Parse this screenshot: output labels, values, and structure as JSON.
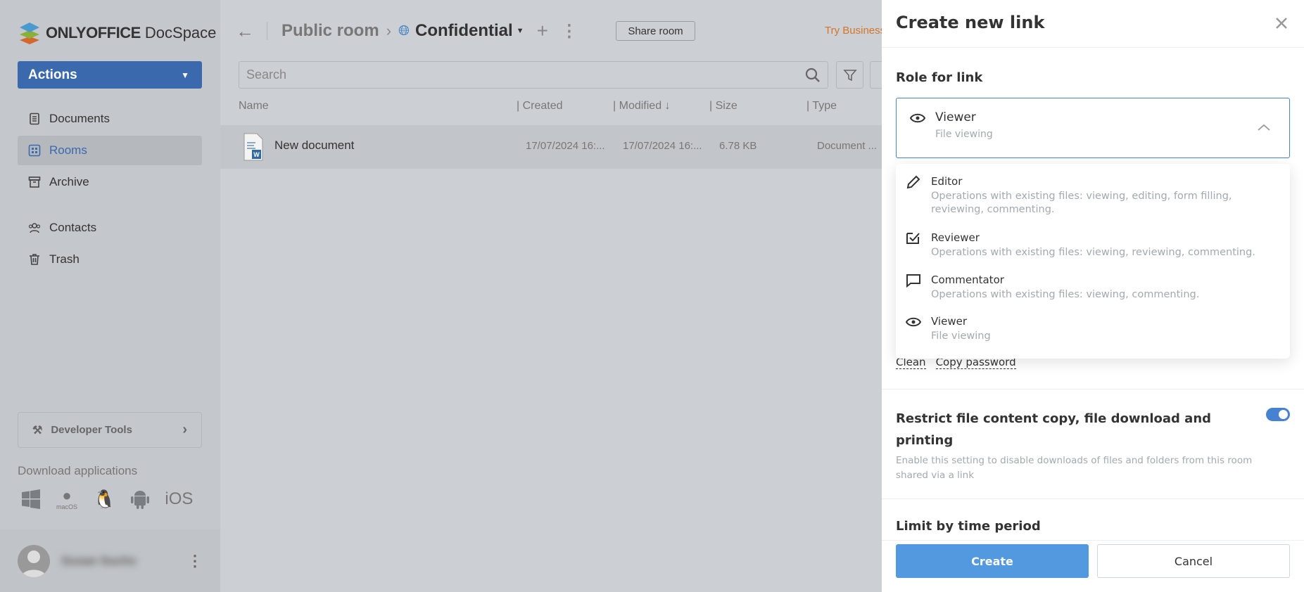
{
  "brand": {
    "logo_bold": "ONLYOFFICE",
    "logo_light": "DocSpace"
  },
  "sidebar": {
    "actions_label": "Actions",
    "items": [
      {
        "label": "Documents",
        "icon": "document-icon"
      },
      {
        "label": "Rooms",
        "icon": "rooms-icon",
        "active": true
      },
      {
        "label": "Archive",
        "icon": "archive-icon"
      },
      {
        "label": "Contacts",
        "icon": "contacts-icon"
      },
      {
        "label": "Trash",
        "icon": "trash-icon"
      }
    ],
    "developer_tools": "Developer Tools",
    "download_label": "Download applications",
    "apps": [
      "windows",
      "macOS",
      "linux",
      "android",
      "iOS"
    ],
    "macos_label": "macOS",
    "ios_label": "iOS",
    "user_name": "Susan Suchs"
  },
  "header": {
    "parent": "Public room",
    "current": "Confidential",
    "share_button": "Share room",
    "try_business": "Try Business"
  },
  "search": {
    "placeholder": "Search"
  },
  "table": {
    "columns": [
      "Name",
      "Created",
      "Modified ↓",
      "Size",
      "Type"
    ],
    "rows": [
      {
        "name": "New document",
        "created": "17/07/2024 16:...",
        "modified": "17/07/2024 16:...",
        "size": "6.78 KB",
        "type": "Document ..."
      }
    ]
  },
  "panel": {
    "title": "Create new link",
    "role_section": "Role for link",
    "selected": {
      "title": "Viewer",
      "desc": "File viewing"
    },
    "options": [
      {
        "title": "Editor",
        "desc": "Operations with existing files: viewing, editing, form filling, reviewing, commenting."
      },
      {
        "title": "Reviewer",
        "desc": "Operations with existing files: viewing, reviewing, commenting."
      },
      {
        "title": "Commentator",
        "desc": "Operations with existing files: viewing, commenting."
      },
      {
        "title": "Viewer",
        "desc": "File viewing"
      }
    ],
    "clean": "Clean",
    "copy_password": "Copy password",
    "restrict_title": "Restrict file content copy, file download and printing",
    "restrict_desc": "Enable this setting to disable downloads of files and folders from this room shared via a link",
    "restrict_enabled": true,
    "limit_title": "Limit by time period",
    "create": "Create",
    "cancel": "Cancel"
  },
  "colors": {
    "accent": "#4781d1",
    "create_button": "#5299e0",
    "actions_button": "#3a69ae",
    "try_business": "#d4752a"
  }
}
